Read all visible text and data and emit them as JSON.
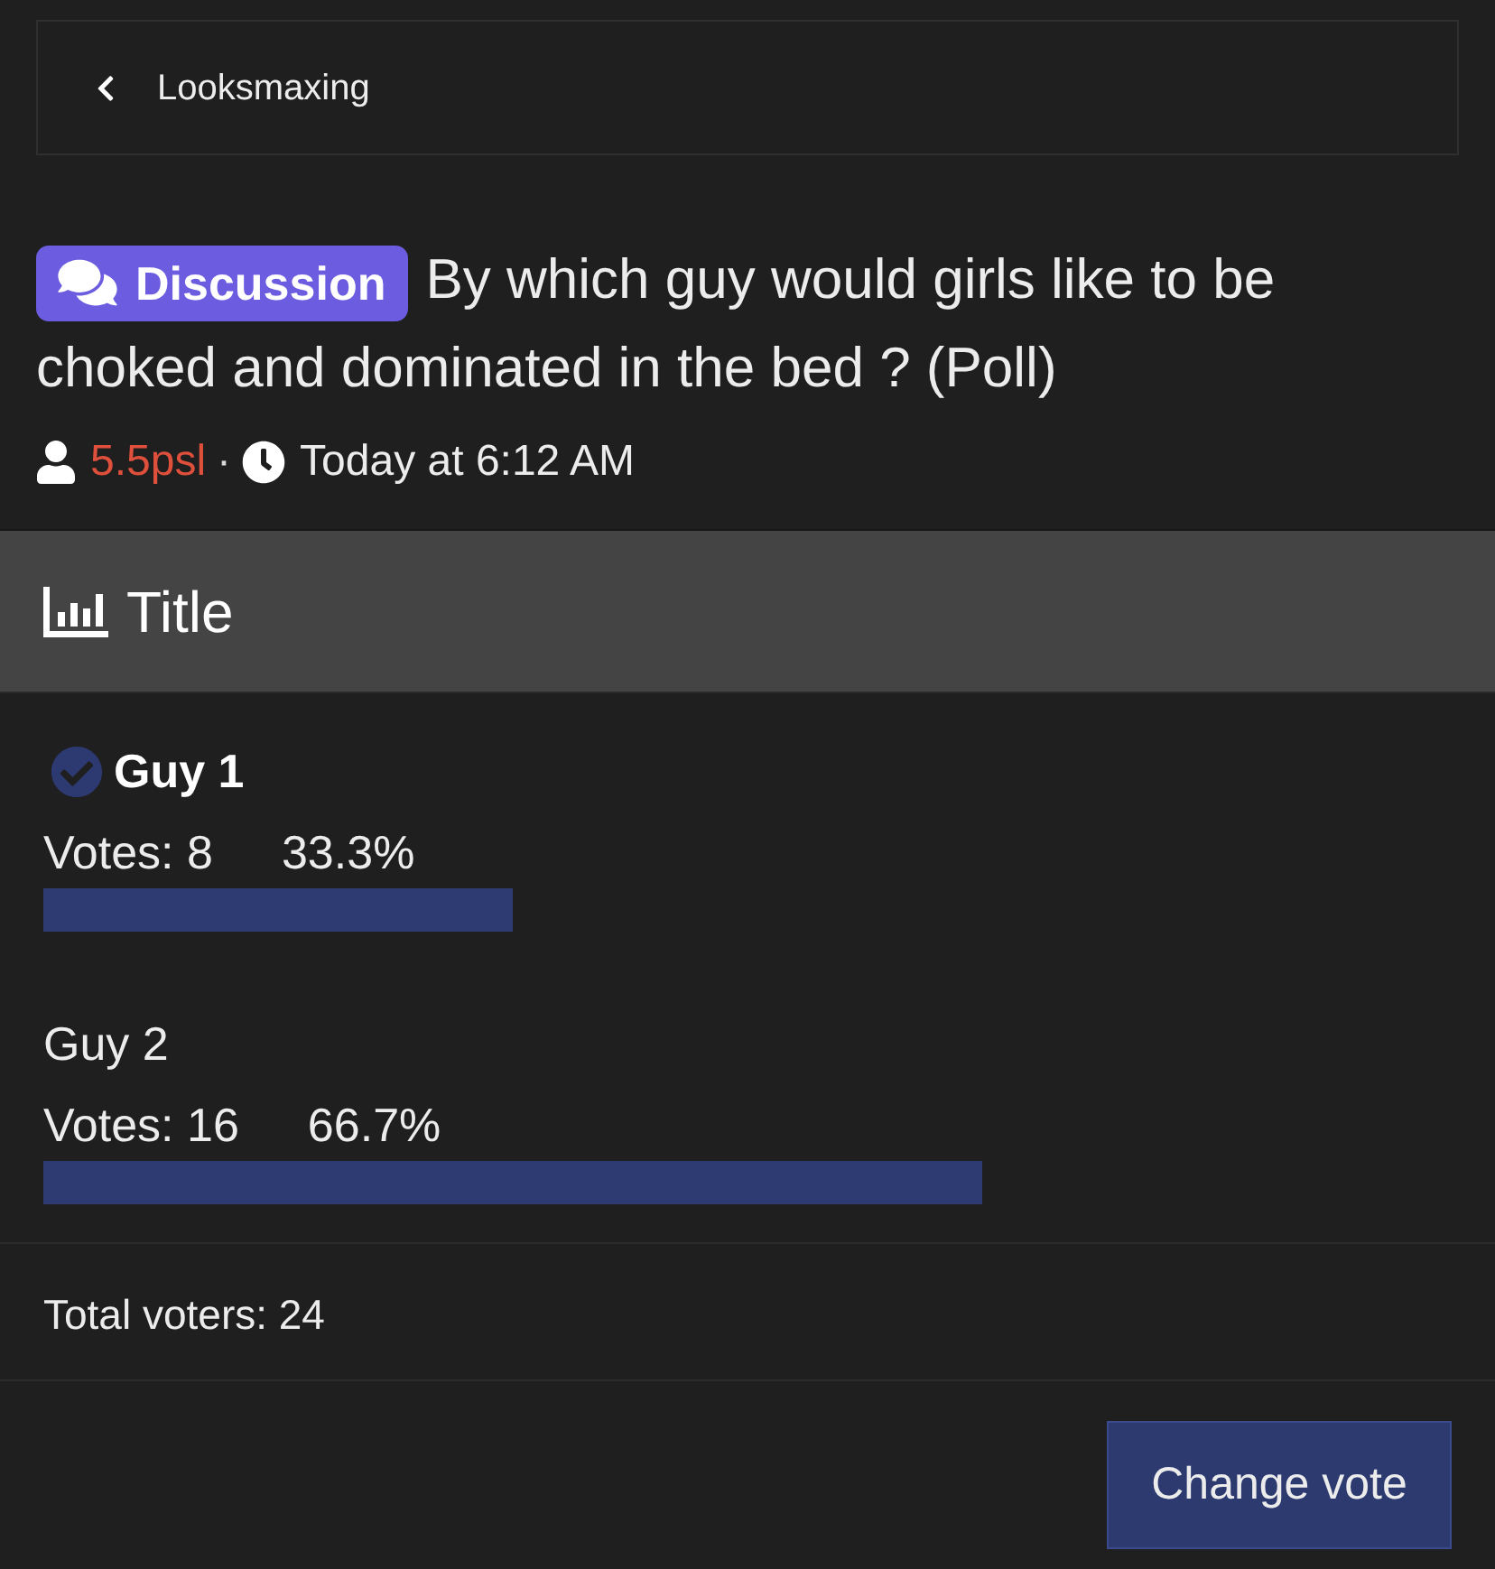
{
  "breadcrumb": {
    "label": "Looksmaxing"
  },
  "thread": {
    "prefix": {
      "label": "Discussion"
    },
    "title": [
      "By which guy would girls like to be",
      "choked and dominated in the bed ? (Poll)"
    ],
    "author": "5.5psl",
    "separator": "·",
    "date": "Today at 6:12 AM"
  },
  "poll": {
    "title": "Title",
    "options": [
      {
        "label": "Guy 1",
        "selected": true,
        "votes": "Votes: 8",
        "percent": "33.3%",
        "level": 0.333
      },
      {
        "label": "Guy 2",
        "selected": false,
        "votes": "Votes: 16",
        "percent": "66.7%",
        "level": 0.667
      }
    ],
    "total": "Total voters: 24",
    "button": "Change vote"
  }
}
